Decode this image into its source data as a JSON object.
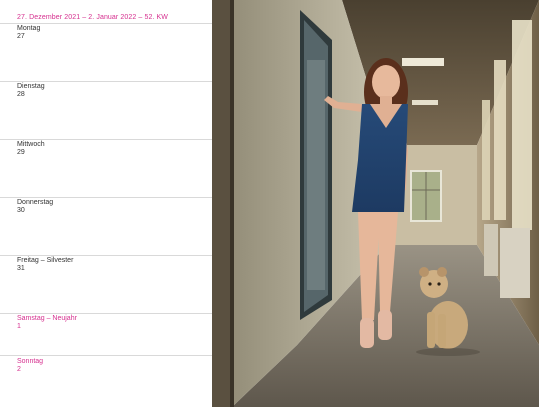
{
  "header": "27. Dezember 2021 – 2. Januar 2022 – 52. KW",
  "days": [
    {
      "name": "Montag",
      "date": "27",
      "special": false
    },
    {
      "name": "Dienstag",
      "date": "28",
      "special": false
    },
    {
      "name": "Mittwoch",
      "date": "29",
      "special": false
    },
    {
      "name": "Donnerstag",
      "date": "30",
      "special": false
    },
    {
      "name": "Freitag – Silvester",
      "date": "31",
      "special": false
    },
    {
      "name": "Samstag – Neujahr",
      "date": "1",
      "special": true
    },
    {
      "name": "Sonntag",
      "date": "2",
      "special": true
    }
  ],
  "colors": {
    "accent": "#d6308f",
    "text": "#333333",
    "rule": "#d9d9d9"
  }
}
